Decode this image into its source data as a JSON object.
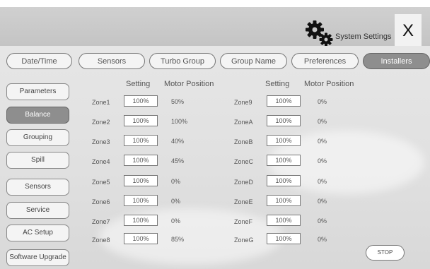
{
  "header": {
    "title": "System Settings",
    "close_label": "X"
  },
  "tabs": [
    "Date/Time",
    "Sensors",
    "Turbo Group",
    "Group Name",
    "Preferences",
    "Installers"
  ],
  "active_tab": "Installers",
  "sidebar": [
    "Parameters",
    "Balance",
    "Grouping",
    "Spill",
    "Sensors",
    "Service",
    "AC Setup",
    "Software Upgrade"
  ],
  "active_sidebar": "Balance",
  "columns": {
    "setting_header": "Setting",
    "motor_header": "Motor Position"
  },
  "zones_left": [
    {
      "name": "Zone1",
      "setting": "100%",
      "motor": "50%"
    },
    {
      "name": "Zone2",
      "setting": "100%",
      "motor": "100%"
    },
    {
      "name": "Zone3",
      "setting": "100%",
      "motor": "40%"
    },
    {
      "name": "Zone4",
      "setting": "100%",
      "motor": "45%"
    },
    {
      "name": "Zone5",
      "setting": "100%",
      "motor": "0%"
    },
    {
      "name": "Zone6",
      "setting": "100%",
      "motor": "0%"
    },
    {
      "name": "Zone7",
      "setting": "100%",
      "motor": "0%"
    },
    {
      "name": "Zone8",
      "setting": "100%",
      "motor": "85%"
    }
  ],
  "zones_right": [
    {
      "name": "Zone9",
      "setting": "100%",
      "motor": "0%"
    },
    {
      "name": "ZoneA",
      "setting": "100%",
      "motor": "0%"
    },
    {
      "name": "ZoneB",
      "setting": "100%",
      "motor": "0%"
    },
    {
      "name": "ZoneC",
      "setting": "100%",
      "motor": "0%"
    },
    {
      "name": "ZoneD",
      "setting": "100%",
      "motor": "0%"
    },
    {
      "name": "ZoneE",
      "setting": "100%",
      "motor": "0%"
    },
    {
      "name": "ZoneF",
      "setting": "100%",
      "motor": "0%"
    },
    {
      "name": "ZoneG",
      "setting": "100%",
      "motor": "0%"
    }
  ],
  "stop_label": "STOP"
}
